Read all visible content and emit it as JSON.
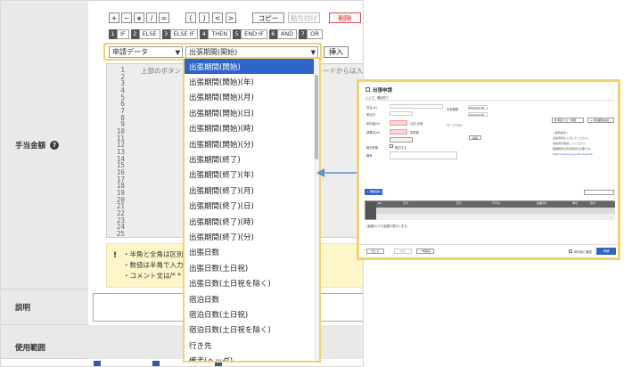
{
  "toolbar_row1": [
    "+",
    "−",
    "∗",
    "/",
    "=",
    "(",
    ")",
    "<",
    ">"
  ],
  "copy_label": "コピー",
  "paste_label": "貼り付け",
  "delete_label": "削除",
  "keywords": [
    {
      "n": "1",
      "t": "IF"
    },
    {
      "n": "2",
      "t": "ELSE"
    },
    {
      "n": "3",
      "t": "ELSE IF"
    },
    {
      "n": "4",
      "t": "THEN"
    },
    {
      "n": "5",
      "t": "END IF"
    },
    {
      "n": "6",
      "t": "AND"
    },
    {
      "n": "7",
      "t": "OR"
    }
  ],
  "select1": "申請データ",
  "select2": "出張期間(開始)",
  "insert_label": "挿入",
  "editor_line1": "上部のボタン",
  "editor_line1_right": "ードからは入",
  "line_numbers": [
    "1",
    "2",
    "3",
    "4",
    "5",
    "6",
    "7",
    "8",
    "9",
    "10",
    "11",
    "12",
    "13",
    "14",
    "15",
    "16",
    "17",
    "18",
    "19",
    "20",
    "21",
    "22",
    "23",
    "24",
    "25"
  ],
  "dropdown": [
    "出張期間(開始)",
    "出張期間(開始)(年)",
    "出張期間(開始)(月)",
    "出張期間(開始)(日)",
    "出張期間(開始)(時)",
    "出張期間(開始)(分)",
    "出張期間(終了)",
    "出張期間(終了)(年)",
    "出張期間(終了)(月)",
    "出張期間(終了)(日)",
    "出張期間(終了)(時)",
    "出張期間(終了)(分)",
    "出張日数",
    "出張日数(土日祝)",
    "出張日数(土日祝を除く)",
    "宿泊日数",
    "宿泊日数(土日祝)",
    "宿泊日数(土日祝を除く)",
    "行き先",
    "備考(ヘッダ)"
  ],
  "notes": [
    "・半角と全角は区別",
    "・数値は半角で入力",
    "・コメント文は/* *"
  ],
  "labels": {
    "allowance": "手当金額",
    "description": "説明",
    "scope": "使用範囲"
  },
  "panel": {
    "title": "出張申請",
    "subtitle": "1.入力　確認完了",
    "field_labels": [
      "件名(※)",
      "申請日",
      "申請者(※)",
      "部署名(※)",
      "宿泊有無",
      "備考"
    ],
    "name_val": "山田 太郎",
    "dept_val": "営業部",
    "stay_label": "宿泊する",
    "start_label": "出張期間",
    "end_label": "ワークフロー",
    "date1": "2020/11/18",
    "date2": "2020/11/20",
    "wf_btn": "承認",
    "add_btn": "+ 明細追加",
    "right_btns": [
      "▼ 承認フロー参照",
      "+ 申請要素指定"
    ],
    "right_notes": [
      "<留意事項>",
      "出張申請を入力してください。",
      "承認者を確認してください。",
      "経費精算は別途申請が必要です。"
    ],
    "link": "https://example.jp/docs/guide",
    "table_head": [
      "No",
      "日付",
      "区分",
      "行き先",
      "金額(円)",
      "単位",
      "合計"
    ],
    "table_footer": "(金額)のうち金額を表示します。",
    "footer_btns": [
      "閉じる",
      "保存",
      "一時保存"
    ],
    "confirm_label": "申請前に確認",
    "submit": "申請"
  }
}
